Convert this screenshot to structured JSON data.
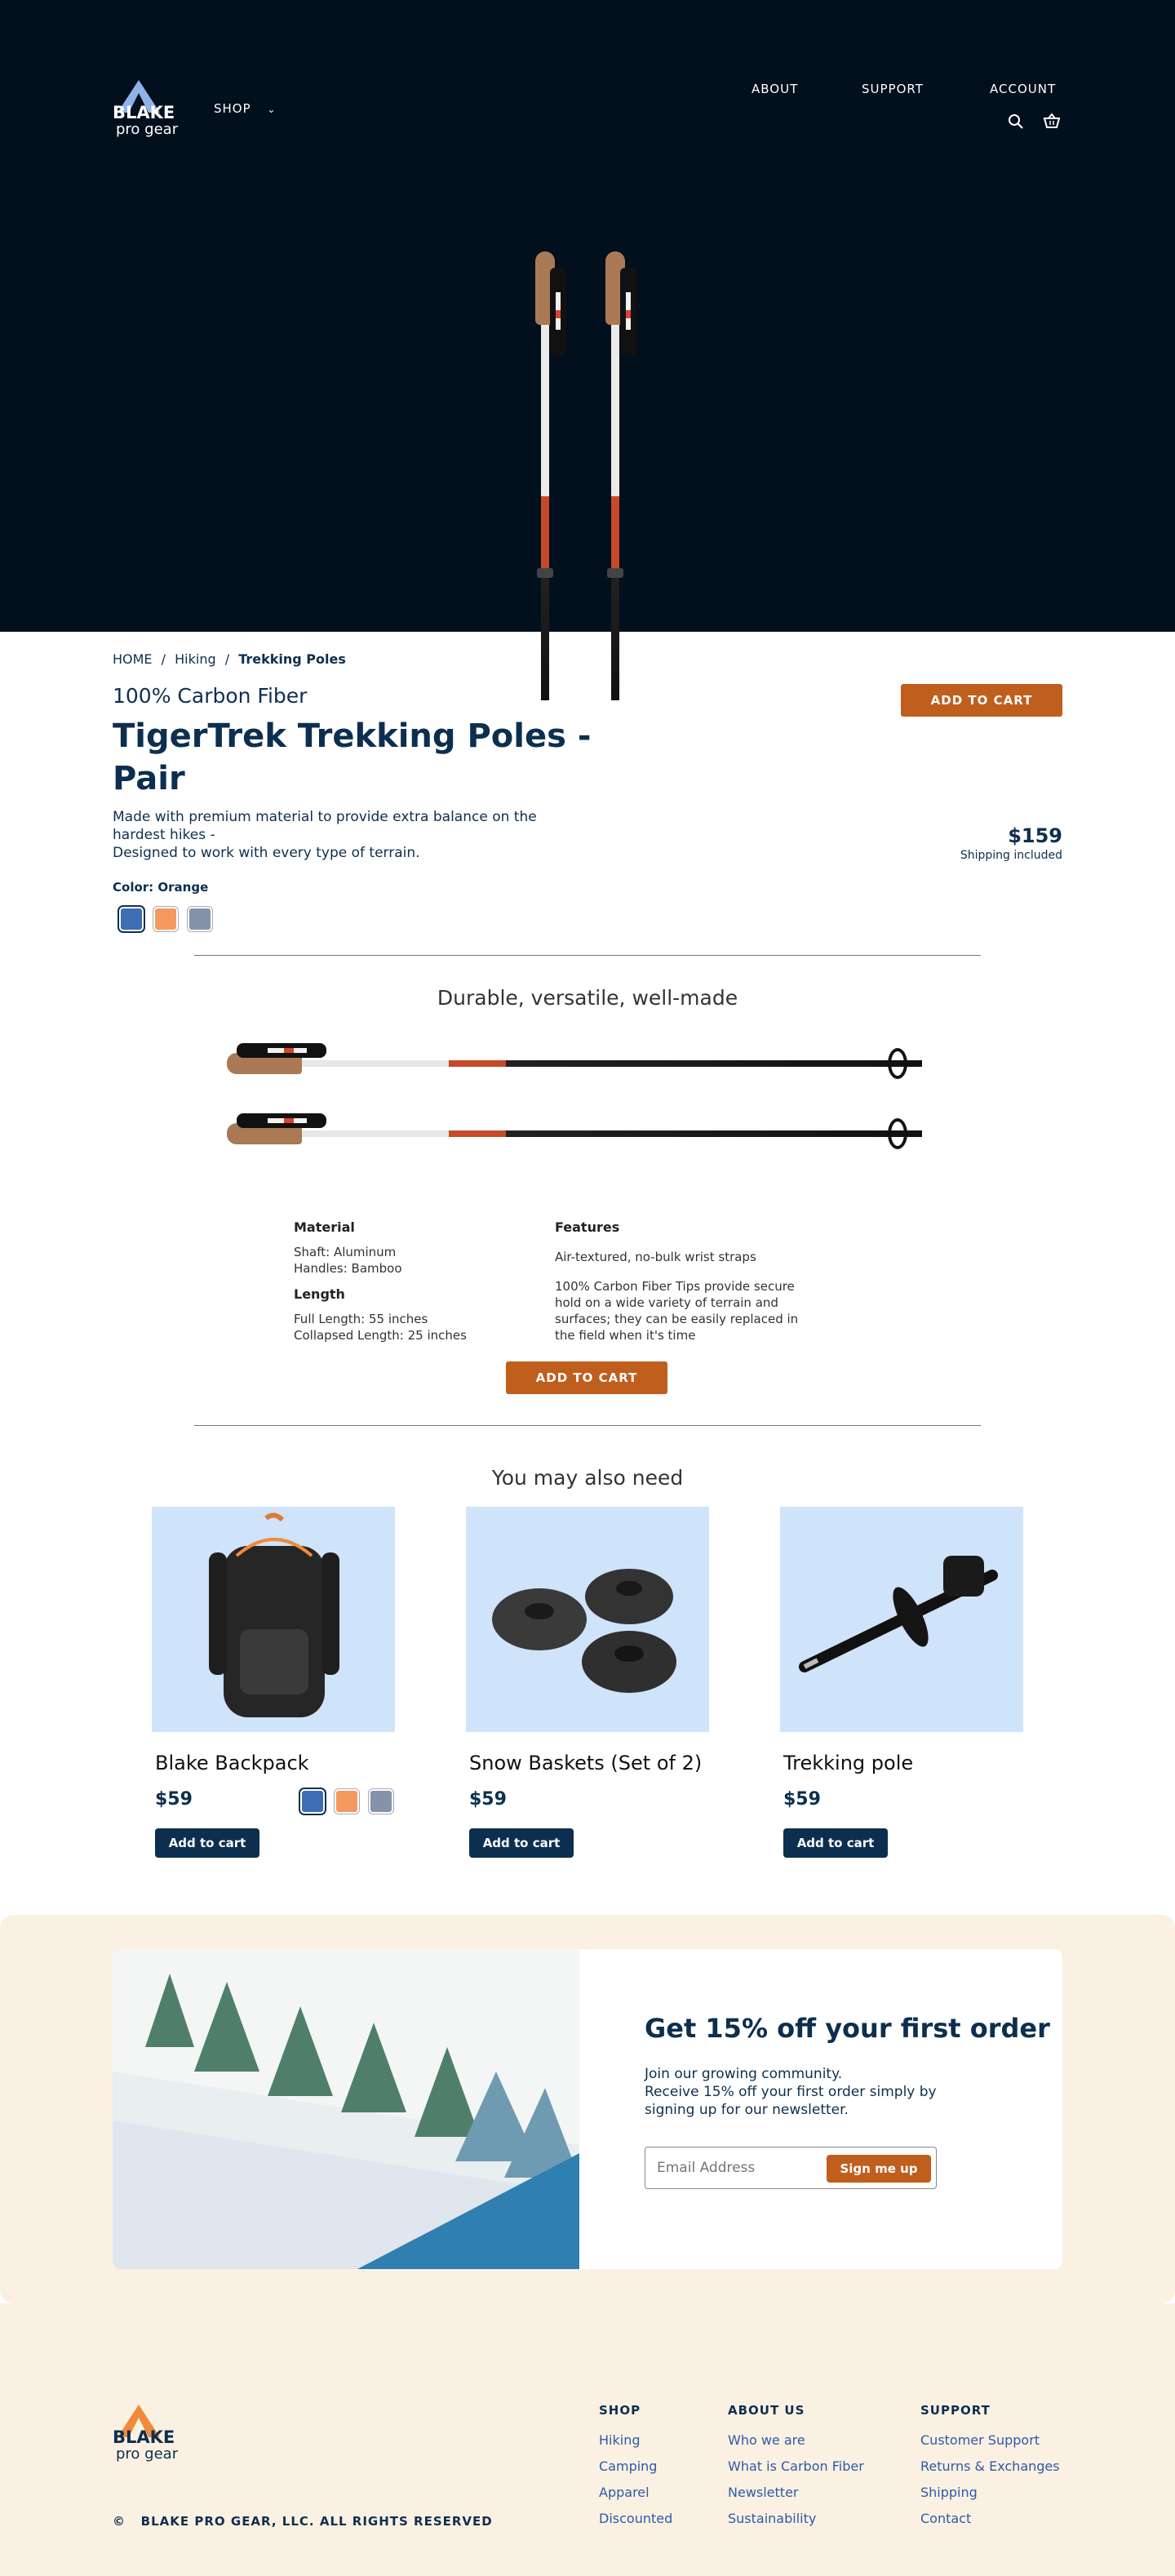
{
  "brand": {
    "word1": "BLAKE",
    "word2": "pro gear"
  },
  "nav": {
    "shop": "SHOP",
    "about": "ABOUT",
    "support": "SUPPORT",
    "account": "ACCOUNT"
  },
  "breadcrumb": {
    "home": "HOME",
    "sep": "/",
    "category": "Hiking",
    "current": "Trekking Poles"
  },
  "product": {
    "eyebrow": "100% Carbon Fiber",
    "title_line1": "TigerTrek Trekking Poles -",
    "title_line2": "Pair",
    "desc_line1": "Made with premium material to provide extra balance on the",
    "desc_line2": "hardest hikes -",
    "desc_line3": "Designed to work with every type of terrain.",
    "color_label": "Color: Orange",
    "swatches": [
      "#3e6db3",
      "#f59a5e",
      "#8493aa"
    ],
    "add_to_cart": "ADD TO CART",
    "price": "$159",
    "shipping": "Shipping included"
  },
  "details": {
    "heading": "Durable, versatile, well-made",
    "material_h": "Material",
    "material_1": "Shaft: Aluminum",
    "material_2": "Handles: Bamboo",
    "length_h": "Length",
    "length_1": "Full Length: 55 inches",
    "length_2": "Collapsed Length: 25 inches",
    "features_h": "Features",
    "feature_1": "Air-textured, no-bulk wrist straps",
    "feature_2a": "100% Carbon Fiber Tips provide secure",
    "feature_2b": "hold on a wide variety of terrain and",
    "feature_2c": "surfaces; they can be easily replaced in",
    "feature_2d": "the field when it's time",
    "add_to_cart": "ADD TO CART"
  },
  "related": {
    "heading": "You may also need",
    "items": [
      {
        "title": "Blake Backpack",
        "price": "$59",
        "button": "Add to cart"
      },
      {
        "title": "Snow Baskets (Set of 2)",
        "price": "$59",
        "button": "Add to cart"
      },
      {
        "title": "Trekking pole",
        "price": "$59",
        "button": "Add to cart"
      }
    ],
    "swatches": [
      "#3e6db3",
      "#f59a5e",
      "#8493aa"
    ]
  },
  "newsletter": {
    "title": "Get 15% off your first order",
    "line1": "Join our growing community.",
    "line2": "Receive 15% off your first order simply by",
    "line3": "signing up for our newsletter.",
    "placeholder": "Email Address",
    "button": "Sign me up"
  },
  "footer": {
    "copyright": "©   BLAKE PRO GEAR, LLC. ALL RIGHTS RESERVED",
    "shop": {
      "heading": "SHOP",
      "links": [
        "Hiking",
        "Camping",
        "Apparel",
        "Discounted"
      ]
    },
    "about": {
      "heading": "ABOUT US",
      "links": [
        "Who we are",
        "What is Carbon Fiber",
        "Newsletter",
        "Sustainability"
      ]
    },
    "support": {
      "heading": "SUPPORT",
      "links": [
        "Customer Support",
        "Returns & Exchanges",
        "Shipping",
        "Contact"
      ]
    }
  }
}
